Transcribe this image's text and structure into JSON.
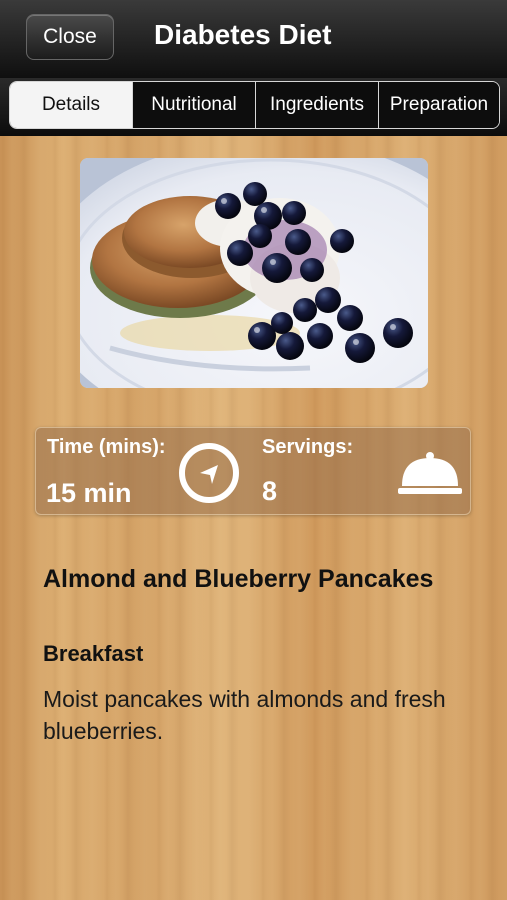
{
  "header": {
    "close_label": "Close",
    "title": "Diabetes Diet"
  },
  "tabs": [
    {
      "label": "Details",
      "active": true
    },
    {
      "label": "Nutritional",
      "active": false
    },
    {
      "label": "Ingredients",
      "active": false
    },
    {
      "label": "Preparation",
      "active": false
    }
  ],
  "photo": {
    "subject": "almond blueberry pancakes with yogurt and blueberries",
    "icon": "recipe-photo"
  },
  "stats": {
    "time_label": "Time (mins):",
    "time_value": "15 min",
    "time_icon": "clock-icon",
    "servings_label": "Servings:",
    "servings_value": "8",
    "servings_icon": "cloche-icon"
  },
  "recipe": {
    "title": "Almond and Blueberry Pancakes",
    "category": "Breakfast",
    "description": "Moist pancakes with almonds and fresh blueberries."
  },
  "colors": {
    "navbar": "#111111",
    "active_tab_bg": "#f4f4f4",
    "wood": "#d7aa6d",
    "stats_panel": "#96704b"
  }
}
